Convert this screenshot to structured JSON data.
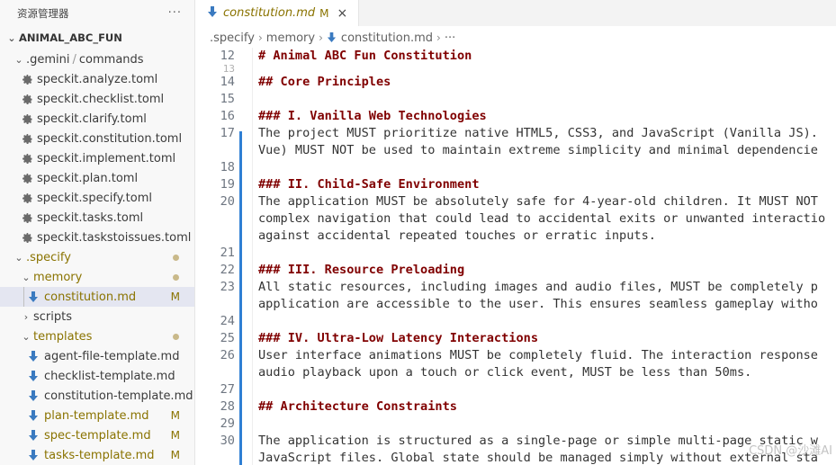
{
  "sidebar": {
    "title": "资源管理器",
    "more": "···",
    "section": "ANIMAL_ABC_FUN",
    "gemini_folder": ".gemini",
    "gemini_sub": "commands",
    "gemini_sep": "/",
    "gemini_files": [
      "speckit.analyze.toml",
      "speckit.checklist.toml",
      "speckit.clarify.toml",
      "speckit.constitution.toml",
      "speckit.implement.toml",
      "speckit.plan.toml",
      "speckit.specify.toml",
      "speckit.tasks.toml",
      "speckit.taskstoissues.toml"
    ],
    "specify_folder": ".specify",
    "memory_folder": "memory",
    "constitution_file": "constitution.md",
    "constitution_badge": "M",
    "scripts_folder": "scripts",
    "templates_folder": "templates",
    "templates": [
      {
        "name": "agent-file-template.md",
        "badge": ""
      },
      {
        "name": "checklist-template.md",
        "badge": ""
      },
      {
        "name": "constitution-template.md",
        "badge": ""
      },
      {
        "name": "plan-template.md",
        "badge": "M"
      },
      {
        "name": "spec-template.md",
        "badge": "M"
      },
      {
        "name": "tasks-template.md",
        "badge": "M"
      }
    ]
  },
  "tab": {
    "title": "constitution.md",
    "badge": "M",
    "close": "×"
  },
  "breadcrumb": {
    "items": [
      ".specify",
      "memory",
      "constitution.md",
      "···"
    ]
  },
  "code": {
    "lines": [
      {
        "n": "12",
        "text": "# Animal ABC Fun Constitution",
        "heading": true
      },
      {
        "n": "13",
        "text": "",
        "heading": false,
        "faint": true
      },
      {
        "n": "14",
        "text": "## Core Principles",
        "heading": true
      },
      {
        "n": "15",
        "text": "",
        "heading": false
      },
      {
        "n": "16",
        "text": "### I. Vanilla Web Technologies",
        "heading": true
      },
      {
        "n": "17",
        "text": "The project MUST prioritize native HTML5, CSS3, and JavaScript (Vanilla JS).",
        "heading": false
      },
      {
        "n": "",
        "text": "Vue) MUST NOT be used to maintain extreme simplicity and minimal dependencie",
        "heading": false
      },
      {
        "n": "18",
        "text": "",
        "heading": false
      },
      {
        "n": "19",
        "text": "### II. Child-Safe Environment",
        "heading": true
      },
      {
        "n": "20",
        "text": "The application MUST be absolutely safe for 4-year-old children. It MUST NOT",
        "heading": false
      },
      {
        "n": "",
        "text": "complex navigation that could lead to accidental exits or unwanted interactio",
        "heading": false
      },
      {
        "n": "",
        "text": "against accidental repeated touches or erratic inputs.",
        "heading": false
      },
      {
        "n": "21",
        "text": "",
        "heading": false
      },
      {
        "n": "22",
        "text": "### III. Resource Preloading",
        "heading": true
      },
      {
        "n": "23",
        "text": "All static resources, including images and audio files, MUST be completely p",
        "heading": false
      },
      {
        "n": "",
        "text": "application are accessible to the user. This ensures seamless gameplay witho",
        "heading": false
      },
      {
        "n": "24",
        "text": "",
        "heading": false
      },
      {
        "n": "25",
        "text": "### IV. Ultra-Low Latency Interactions",
        "heading": true
      },
      {
        "n": "26",
        "text": "User interface animations MUST be completely fluid. The interaction response",
        "heading": false
      },
      {
        "n": "",
        "text": "audio playback upon a touch or click event, MUST be less than 50ms.",
        "heading": false
      },
      {
        "n": "27",
        "text": "",
        "heading": false
      },
      {
        "n": "28",
        "text": "## Architecture Constraints",
        "heading": true
      },
      {
        "n": "29",
        "text": "",
        "heading": false
      },
      {
        "n": "30",
        "text": "The application is structured as a single-page or simple multi-page static w",
        "heading": false
      },
      {
        "n": "",
        "text": "JavaScript files. Global state should be managed simply without external sta",
        "heading": false
      }
    ]
  },
  "watermark": "CSDN @沙滩AI",
  "colors": {
    "accent": "#2f7fd4",
    "modified": "#8a7300",
    "heading": "#800000",
    "selected": "#e4e6f1"
  }
}
